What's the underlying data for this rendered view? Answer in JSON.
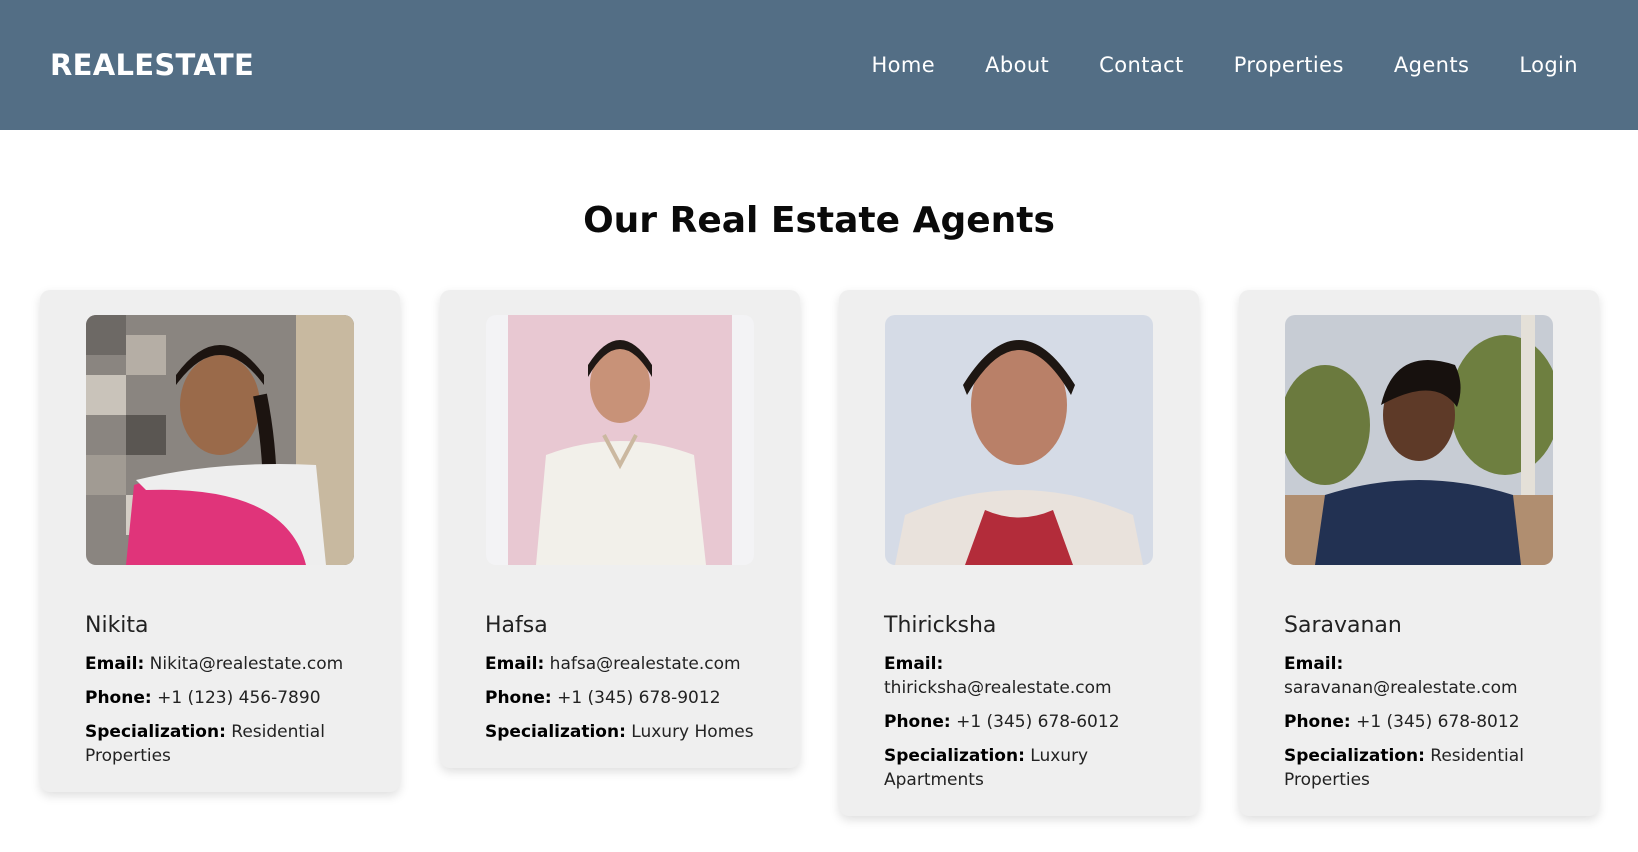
{
  "nav": {
    "brand": "REALESTATE",
    "links": [
      "Home",
      "About",
      "Contact",
      "Properties",
      "Agents",
      "Login"
    ]
  },
  "page": {
    "heading": "Our Real Estate Agents"
  },
  "labels": {
    "email": "Email:",
    "phone": "Phone:",
    "specialization": "Specialization:"
  },
  "agents": [
    {
      "name": "Nikita",
      "email": "Nikita@realestate.com",
      "phone": "+1 (123) 456-7890",
      "specialization": "Residential Properties"
    },
    {
      "name": "Hafsa",
      "email": "hafsa@realestate.com",
      "phone": "+1 (345) 678-9012",
      "specialization": "Luxury Homes"
    },
    {
      "name": "Thiricksha",
      "email": "thiricksha@realestate.com",
      "phone": "+1 (345) 678-6012",
      "specialization": "Luxury Apartments"
    },
    {
      "name": "Saravanan",
      "email": "saravanan@realestate.com",
      "phone": "+1 (345) 678-8012",
      "specialization": "Residential Properties"
    }
  ],
  "colors": {
    "navbar": "#536e85",
    "card": "#efefef"
  }
}
